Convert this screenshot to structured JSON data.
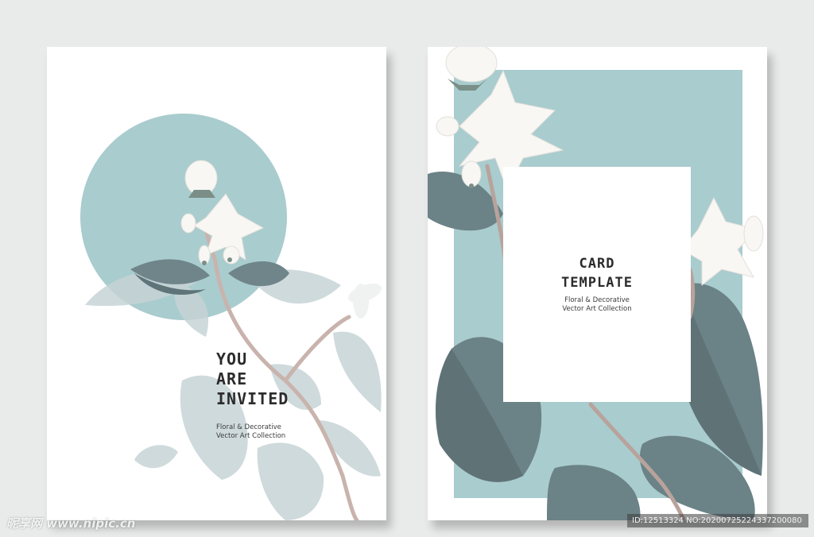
{
  "colors": {
    "background": "#e9eaea",
    "card": "#ffffff",
    "accent_blue": "#a9ccce",
    "leaf_dark": "#6b8287",
    "leaf_light": "#c7d4d6",
    "stem": "#b59a92",
    "flower": "#f8f7f4"
  },
  "left_card": {
    "title_lines": [
      "YOU",
      "ARE",
      "INVITED"
    ],
    "subtitle_lines": [
      "Floral & Decorative",
      "Vector Art Collection"
    ]
  },
  "right_card": {
    "title_lines": [
      "CARD",
      "TEMPLATE"
    ],
    "subtitle_lines": [
      "Floral & Decorative",
      "Vector Art Collection"
    ]
  },
  "watermark": {
    "text": "昵享网 www.nipic.cn"
  },
  "id_bar": {
    "text": "ID:12513324 NO:20200725224337200080"
  }
}
